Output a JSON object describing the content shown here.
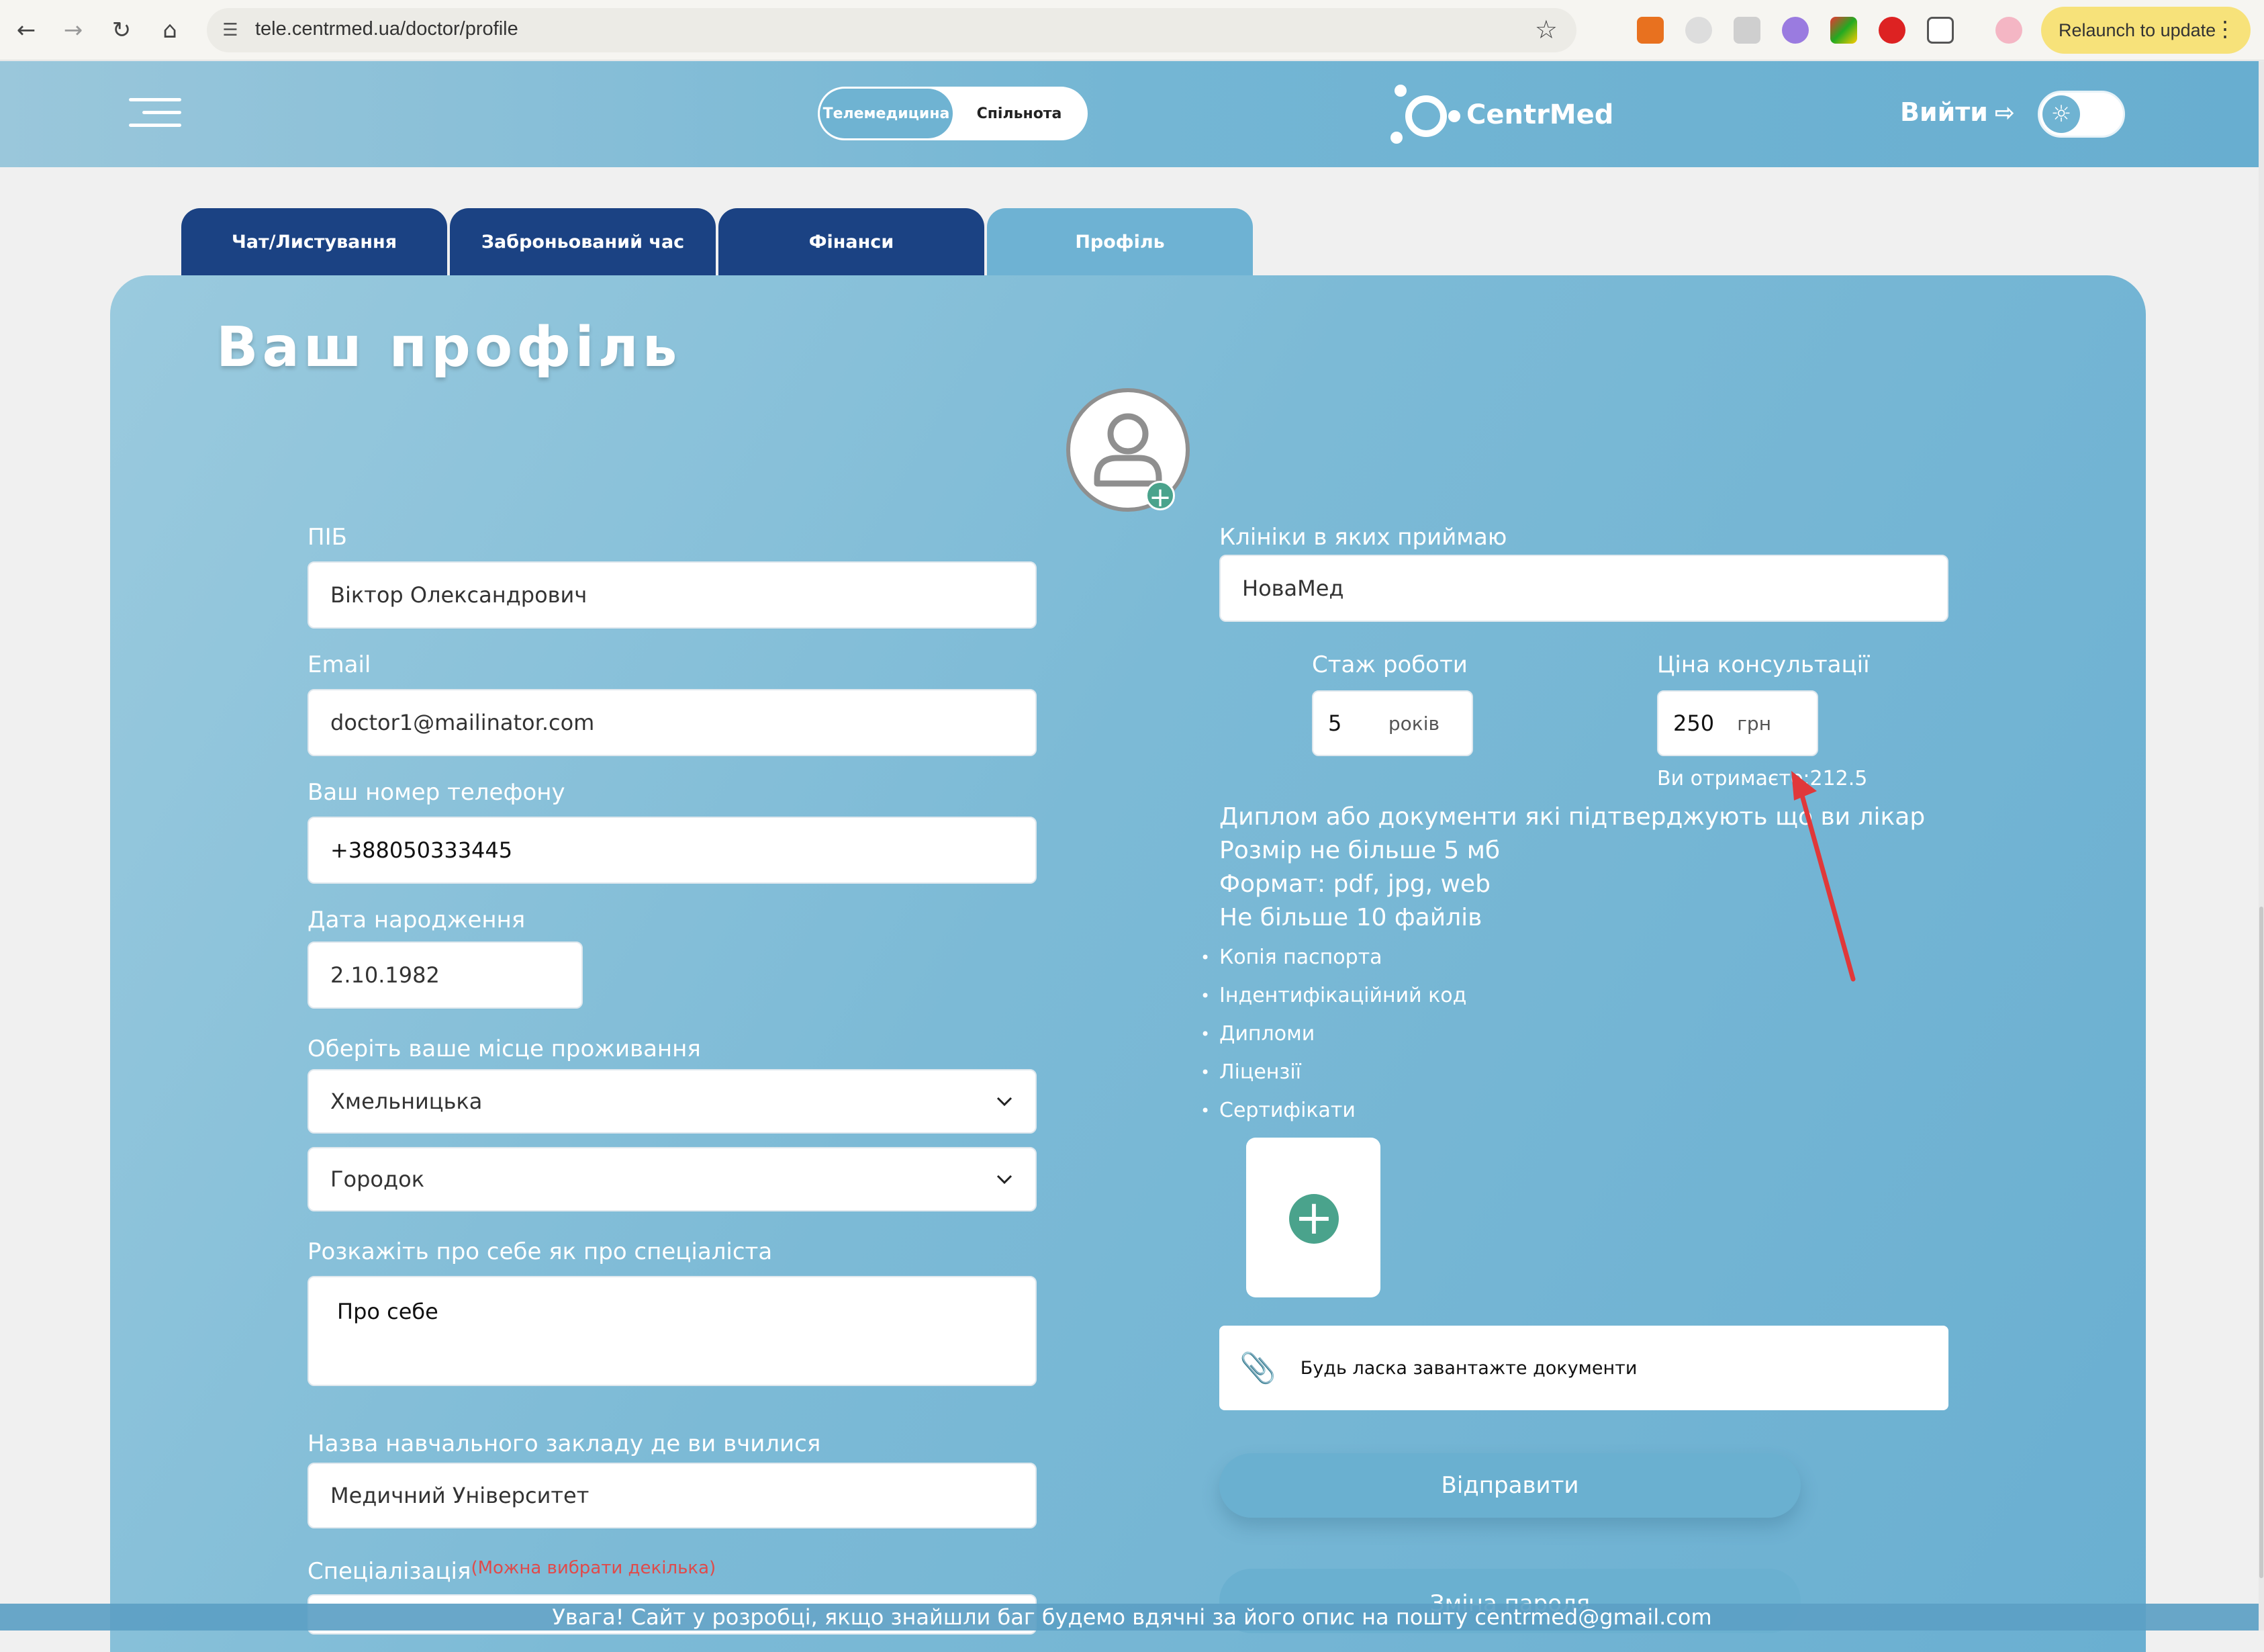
{
  "browser": {
    "url": "tele.centrmed.ua/doctor/profile",
    "relaunch_label": "Relaunch to update"
  },
  "header": {
    "mode_options": [
      "Телемедицина",
      "Спільнота"
    ],
    "logo_text": "CentrMed",
    "logout_label": "Вийти"
  },
  "tabs": [
    {
      "label": "Чат/Листування"
    },
    {
      "label": "Заброньований час"
    },
    {
      "label": "Фінанси"
    },
    {
      "label": "Профіль",
      "active": true
    }
  ],
  "profile": {
    "title": "Ваш профіль",
    "full_name_label": "ПІБ",
    "full_name_value": "Віктор Олександрович",
    "email_label": "Email",
    "email_value": "doctor1@mailinator.com",
    "phone_label": "Ваш номер телефону",
    "phone_value": "+388050333445",
    "birth_label": "Дата народження",
    "birth_value": "2.10.1982",
    "residence_label": "Оберіть ваше місце проживання",
    "region_value": "Хмельницька",
    "city_value": "Городок",
    "about_label": "Розкажіть про себе як про спеціаліста",
    "about_value": "Про себе",
    "education_label": "Назва навчального закладу де ви вчилися",
    "education_value": "Медичний Університет",
    "specialization_label": "Спеціалізація",
    "specialization_hint": "(Можна вибрати декілька)",
    "clinics_label": "Клініки в яких приймаю",
    "clinics_value": "НоваМед",
    "experience_label": "Стаж роботи",
    "experience_value": "5",
    "experience_unit": "років",
    "price_label": "Ціна консультації",
    "price_value": "250",
    "price_unit": "грн",
    "receive_text": "Ви отримаєте:212.5",
    "documents_info": [
      "Диплом або документи які підтверджують що ви лікар",
      "Розмір не більше 5 мб",
      "Формат: pdf, jpg, web",
      "Не більше 10 файлів"
    ],
    "documents_list": [
      "Копія паспорта",
      "Індентифікаційний код",
      "Дипломи",
      "Ліцензії",
      "Сертифікати"
    ],
    "upload_text": "Будь ласка завантажте документи",
    "submit_label": "Відправити",
    "change_password_label": "Зміна пароля"
  },
  "footer_notice": "Увага! Сайт у розробці, якщо знайшли баг будемо вдячні за його опис на пошту centrmed@gmail.com",
  "colors": {
    "header_bg": "#74b6d4",
    "tab_bg": "#1b4283",
    "tab_active_bg": "#6eb2d3",
    "accent_green": "#4aa38c",
    "annotation_red": "#e0383a",
    "hint_red": "#e04a4a"
  }
}
